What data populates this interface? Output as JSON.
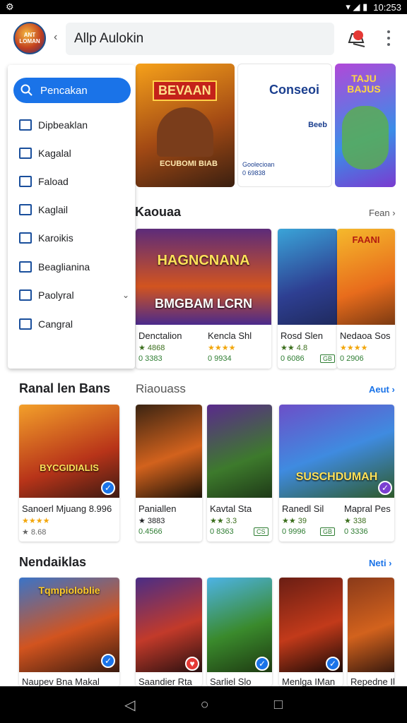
{
  "status_bar": {
    "left_icon": "notification-icon",
    "time": "10:253"
  },
  "header": {
    "logo_text": "ANT LOMAN",
    "back_glyph": "‹",
    "search_value": "Allp Aulokin"
  },
  "menu": {
    "search_label": "Pencakan",
    "items": [
      {
        "label": "Dipbeaklan",
        "icon": "calendar-icon"
      },
      {
        "label": "Kagalal",
        "icon": "gallery-icon"
      },
      {
        "label": "Faload",
        "icon": "check-box-icon"
      },
      {
        "label": "Kaglail",
        "icon": "card-icon"
      },
      {
        "label": "Karoikis",
        "icon": "document-icon"
      },
      {
        "label": "Beaglianina",
        "icon": "mail-icon"
      },
      {
        "label": "Paolyral",
        "icon": "grid-icon",
        "chevron": "⌄"
      },
      {
        "label": "Cangral",
        "icon": "folder-icon"
      }
    ]
  },
  "banners": [
    {
      "title": "BEVAAN",
      "subtitle": "ECUBOMI BIAB"
    },
    {
      "title": "Conseoi",
      "side": "Beeb",
      "footer_line1": "Goolecioan",
      "footer_line2": "0 69838"
    },
    {
      "title": "TAJU BAJUS"
    }
  ],
  "section1": {
    "title": "Kaouaa",
    "more": "Fean ›",
    "cards": [
      {
        "art_label": "HAGNCNANA",
        "art_sub": "BMGBAM LCRN",
        "name": "Denctalion",
        "rating": "★ 4868",
        "price": "0 3383"
      },
      {
        "name": "Kencla Shl",
        "rating": "★★★★",
        "price": "0 9934"
      },
      {
        "name": "Rosd Slen",
        "rating": "★★ 4.8",
        "price": "0 6086",
        "tag": "GB"
      },
      {
        "art_label": "FAANI",
        "name": "Nedaoa Sos",
        "rating": "★★★★",
        "price": "0 2906"
      }
    ]
  },
  "section2": {
    "title": "Ranal len Bans",
    "alt_title": "Riaouass",
    "more": "Aeut ›",
    "cards": [
      {
        "art_label": "BYCGIDIALIS",
        "name": "Sanoerl Mjuang",
        "extra": "8.996",
        "rating": "★ 8.68",
        "price": ""
      },
      {
        "name": "Paniallen",
        "rating": "★ 3883",
        "price": "0.4566"
      },
      {
        "name": "Kavtal Sta",
        "rating": "★★ 3.3",
        "price": "0 8363",
        "tag": "CS"
      },
      {
        "art_label": "SUSCHDUMAH",
        "name": "Ranedl Sil",
        "rating": "★★ 39",
        "price": "0 9996",
        "tag": "GB"
      },
      {
        "name": "Mapral Pes",
        "rating": "★ 338",
        "price": "0 3336"
      }
    ]
  },
  "section3": {
    "title": "Nendaiklas",
    "more": "Neti ›",
    "cards": [
      {
        "art_label": "Tqmpioloblie",
        "name": "Naupev Bna Makal"
      },
      {
        "name": "Saandier Rta"
      },
      {
        "name": "Sarliel Slo"
      },
      {
        "name": "Menlga IMan"
      },
      {
        "name": "Repedne Ilo"
      }
    ]
  },
  "nav": {
    "back": "◁",
    "home": "○",
    "recent": "□"
  }
}
